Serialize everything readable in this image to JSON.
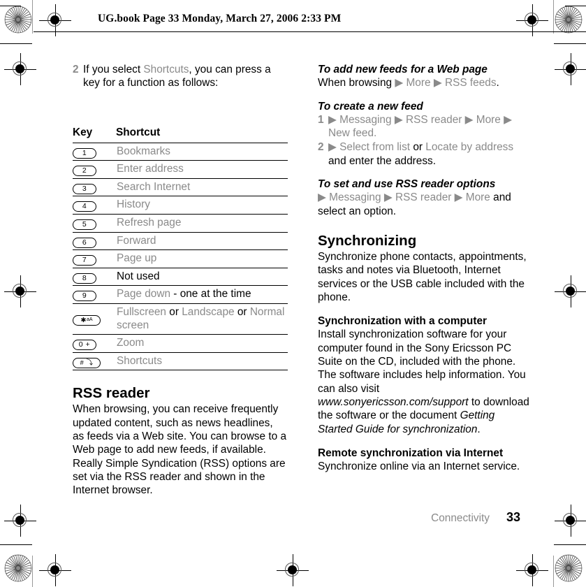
{
  "print_header": "UG.book  Page 33  Monday, March 27, 2006  2:33 PM",
  "left_column": {
    "intro_step": {
      "number": "2",
      "text_before": "If you select ",
      "highlight": "Shortcuts",
      "text_after": ", you can press a key for a function as follows:"
    },
    "table": {
      "headers": [
        "Key",
        "Shortcut"
      ],
      "rows": [
        {
          "key": "1",
          "key_sup": "",
          "shortcut": "Bookmarks",
          "shortcut_black": ""
        },
        {
          "key": "2",
          "key_sup": "",
          "shortcut": "Enter address",
          "shortcut_black": ""
        },
        {
          "key": "3",
          "key_sup": "",
          "shortcut": "Search Internet",
          "shortcut_black": ""
        },
        {
          "key": "4",
          "key_sup": "",
          "shortcut": "History",
          "shortcut_black": ""
        },
        {
          "key": "5",
          "key_sup": "",
          "shortcut": "Refresh page",
          "shortcut_black": ""
        },
        {
          "key": "6",
          "key_sup": "",
          "shortcut": "Forward",
          "shortcut_black": ""
        },
        {
          "key": "7",
          "key_sup": "",
          "shortcut": "Page up",
          "shortcut_black": ""
        },
        {
          "key": "8",
          "key_sup": "",
          "shortcut": "",
          "shortcut_black": "Not used"
        },
        {
          "key": "9",
          "key_sup": "",
          "shortcut": "Page down",
          "shortcut_black": " - one at the time"
        },
        {
          "key": "✱",
          "key_sup": "aA",
          "shortcut": "Fullscreen",
          "shortcut_black": ""
        },
        {
          "key": "0 +",
          "key_sup": "",
          "shortcut": "Zoom",
          "shortcut_black": ""
        },
        {
          "key": "# ⤵",
          "key_sup": "",
          "shortcut": "Shortcuts",
          "shortcut_black": ""
        }
      ],
      "star_row_extra": {
        "or1": " or ",
        "mid": "Landscape",
        "or2": " or ",
        "tail": "Normal screen"
      }
    },
    "rss_reader": {
      "heading": "RSS reader",
      "body": "When browsing, you can receive frequently updated content, such as news headlines, as feeds via a Web site. You can browse to a Web page to add new feeds, if available. Really Simple Syndication (RSS) options are set via the RSS reader and shown in the Internet browser."
    }
  },
  "right_column": {
    "add_feeds": {
      "heading": "To add new feeds for a Web page",
      "line_start": "When browsing ",
      "arrow": "▶",
      "item1": "More",
      "item2": "RSS feeds",
      "period": "."
    },
    "create_feed": {
      "heading": "To create a new feed",
      "steps": [
        {
          "number": "1",
          "parts": [
            "Messaging",
            "RSS reader",
            "More",
            "New feed."
          ]
        },
        {
          "number": "2",
          "lead": "Select from list",
          "mid": " or ",
          "second": "Locate by address",
          "tail": " and enter the address."
        }
      ]
    },
    "rss_options": {
      "heading": "To set and use RSS reader options",
      "parts": [
        "Messaging",
        "RSS reader",
        "More"
      ],
      "tail": "and select an option."
    },
    "synchronizing": {
      "heading": "Synchronizing",
      "body": "Synchronize phone contacts, appointments, tasks and notes via Bluetooth, Internet services or the USB cable included with the phone.",
      "sub1": {
        "heading": "Synchronization with a computer",
        "text_1": "Install synchronization software for your computer found in the Sony Ericsson PC Suite on the CD, included with the phone. The software includes help information. You can also visit ",
        "url": "www.sonyericsson.com/support",
        "text_2": " to download the software or the document ",
        "doc_title": "Getting Started Guide for synchronization",
        "text_3": "."
      },
      "sub2": {
        "heading": "Remote synchronization via Internet",
        "text": "Synchronize online via an Internet service."
      }
    }
  },
  "footer": {
    "chapter": "Connectivity",
    "page_number": "33"
  },
  "colors": {
    "highlight_gray": "#8a8a8a",
    "text_black": "#000000",
    "rule": "#000000"
  }
}
